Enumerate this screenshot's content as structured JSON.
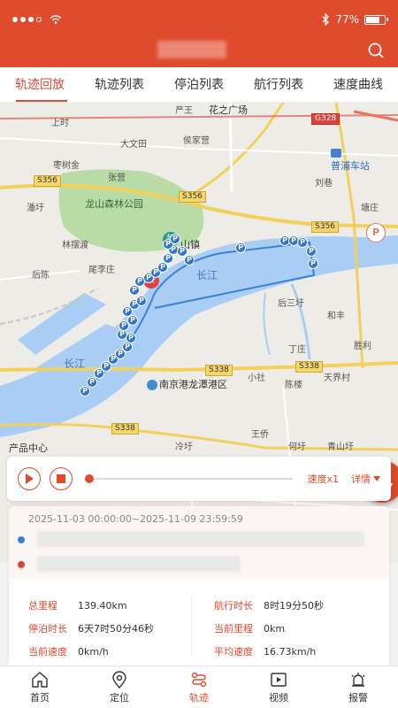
{
  "status_bar": {
    "battery": "77%",
    "battery_level": 0.77
  },
  "tabs": [
    {
      "label": "轨迹回放",
      "active": true
    },
    {
      "label": "轨迹列表",
      "active": false
    },
    {
      "label": "停泊列表",
      "active": false
    },
    {
      "label": "航行列表",
      "active": false
    },
    {
      "label": "速度曲线",
      "active": false
    }
  ],
  "map": {
    "places": {
      "yanwei": "严王",
      "huazhi": "花之广场",
      "shangshi": "上时",
      "dawengtian": "大文田",
      "houjiaying": "侯家营",
      "zhuanghu": "枣树金",
      "zhangying": "张营",
      "puwei": "潘圩",
      "liuxiang": "刘巷",
      "dangzhuang": "塘庄",
      "linqiaoyuan": "林摆渡",
      "weilizhuang": "尾李庄",
      "houchen": "后陈",
      "shanzhen": "山镇",
      "housanyu": "后三圩",
      "helai": "和丰",
      "dingzhuang": "丁庄",
      "shengli": "胜利",
      "xiaozhuang": "小社",
      "chenlou": "陈楼",
      "tianjie": "天界村",
      "wangqiao": "王侨",
      "lengyu": "冷圩",
      "heyu": "何圩",
      "qingshanyu": "青山圩",
      "chanpin": "产品中心"
    },
    "park_label": "龙山森林公园",
    "river_label_1": "长江",
    "river_label_2": "长江",
    "station": "普浦车站",
    "port": "南京港龙潭港区",
    "roads": {
      "g328": "G328",
      "s356a": "S356",
      "s356b": "S356",
      "s356c": "S356",
      "s338a": "S338",
      "s338b": "S338",
      "s338c": "S338"
    },
    "start_marker": "起",
    "end_marker": "终",
    "parking_symbol": "P"
  },
  "playback": {
    "speed_label": "速度x1",
    "detail_label": "详情"
  },
  "info": {
    "range": "2025-11-03 00:00:00~2025-11-09 23:59:59",
    "stats": {
      "total_mileage_label": "总里程",
      "total_mileage": "139.40km",
      "sail_time_label": "航行时长",
      "sail_time": "8时19分50秒",
      "berth_time_label": "停泊时长",
      "berth_time": "6天7时50分46秒",
      "current_mileage_label": "当前里程",
      "current_mileage": "0km",
      "current_speed_label": "当前速度",
      "current_speed": "0km/h",
      "avg_speed_label": "平均速度",
      "avg_speed": "16.73km/h"
    }
  },
  "bottom_nav": [
    {
      "label": "首页",
      "icon": "home-icon",
      "active": false
    },
    {
      "label": "定位",
      "icon": "location-icon",
      "active": false
    },
    {
      "label": "轨迹",
      "icon": "track-icon",
      "active": true
    },
    {
      "label": "视频",
      "icon": "video-icon",
      "active": false
    },
    {
      "label": "报警",
      "icon": "alarm-icon",
      "active": false
    }
  ],
  "colors": {
    "brand": "#e04a2d",
    "water": "#a9cdf5",
    "park": "#b9dca6",
    "track": "#3b82d6"
  }
}
